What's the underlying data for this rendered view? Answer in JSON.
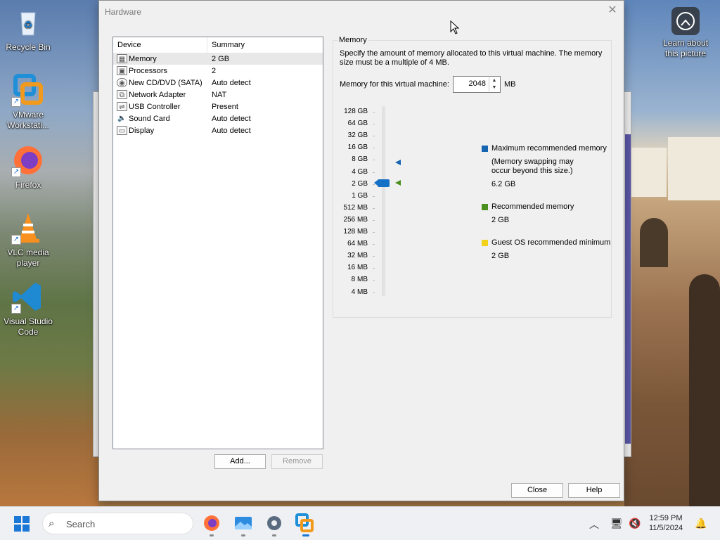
{
  "desktop": {
    "icons": [
      {
        "label": "Recycle Bin"
      },
      {
        "label": "VMware Workstati..."
      },
      {
        "label": "Firefox"
      },
      {
        "label": "VLC media player"
      },
      {
        "label": "Visual Studio Code"
      }
    ],
    "learn": {
      "label": "Learn about this picture"
    }
  },
  "dialog": {
    "title": "Hardware",
    "device_table": {
      "headers": [
        "Device",
        "Summary"
      ],
      "rows": [
        {
          "device": "Memory",
          "summary": "2 GB",
          "icon": "memory-icon"
        },
        {
          "device": "Processors",
          "summary": "2",
          "icon": "cpu-icon"
        },
        {
          "device": "New CD/DVD (SATA)",
          "summary": "Auto detect",
          "icon": "cd-icon"
        },
        {
          "device": "Network Adapter",
          "summary": "NAT",
          "icon": "network-icon"
        },
        {
          "device": "USB Controller",
          "summary": "Present",
          "icon": "usb-icon"
        },
        {
          "device": "Sound Card",
          "summary": "Auto detect",
          "icon": "speaker-icon"
        },
        {
          "device": "Display",
          "summary": "Auto detect",
          "icon": "monitor-icon"
        }
      ]
    },
    "add_label": "Add...",
    "remove_label": "Remove",
    "close_label": "Close",
    "help_label": "Help",
    "memory": {
      "group_title": "Memory",
      "description": "Specify the amount of memory allocated to this virtual machine. The memory size must be a multiple of 4 MB.",
      "field_label": "Memory for this virtual machine:",
      "value": "2048",
      "unit": "MB",
      "scale": [
        "128 GB",
        "64 GB",
        "32 GB",
        "16 GB",
        "8 GB",
        "4 GB",
        "2 GB",
        "1 GB",
        "512 MB",
        "256 MB",
        "128 MB",
        "64 MB",
        "32 MB",
        "16 MB",
        "8 MB",
        "4 MB"
      ],
      "max_recommended": {
        "title": "Maximum recommended memory",
        "note": "(Memory swapping may occur beyond this size.)",
        "value": "6.2 GB",
        "color": "#1565b0"
      },
      "recommended": {
        "title": "Recommended memory",
        "value": "2 GB",
        "color": "#4b8f1f"
      },
      "guest_min": {
        "title": "Guest OS recommended minimum",
        "value": "2 GB",
        "color": "#f2d21b"
      }
    }
  },
  "taskbar": {
    "search_placeholder": "Search",
    "time": "12:59 PM",
    "date": "11/5/2024"
  }
}
